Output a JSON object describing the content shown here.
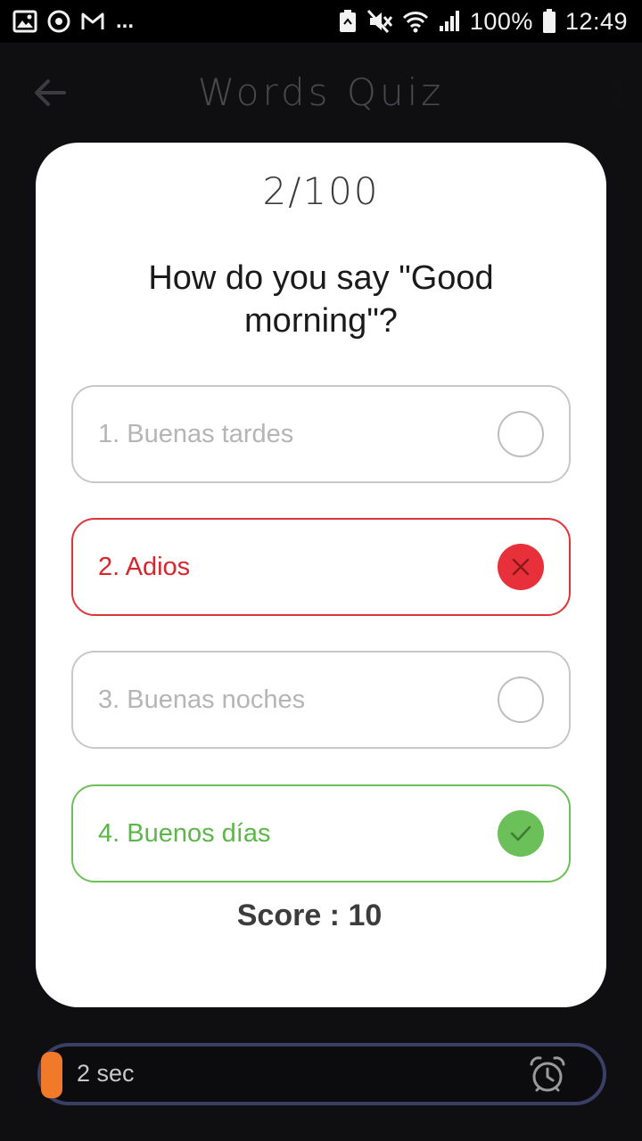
{
  "status_bar": {
    "left_icons": [
      "gallery-icon",
      "timer-icon",
      "gmail-icon"
    ],
    "more": "...",
    "right_icons": [
      "recycle-icon",
      "mute-icon",
      "wifi-icon",
      "signal-icon",
      "battery-icon"
    ],
    "battery": "100%",
    "time": "12:49"
  },
  "app_bar": {
    "title": "Words Quiz",
    "back_icon": "arrow-left-icon",
    "theme_icon": "moon-icon"
  },
  "quiz": {
    "counter": "2/100",
    "question": "How do you say \"Good morning\"?",
    "options": [
      {
        "label": "1. Buenas tardes",
        "state": "neutral"
      },
      {
        "label": "2. Adios",
        "state": "wrong"
      },
      {
        "label": "3. Buenas noches",
        "state": "neutral"
      },
      {
        "label": "4. Buenos días",
        "state": "correct"
      }
    ],
    "score": "Score : 10"
  },
  "timer": {
    "text": "2 sec",
    "icon": "alarm-clock-icon"
  },
  "colors": {
    "wrong": "#e8303a",
    "correct": "#6cc05a",
    "timer_fill": "#f07a2a",
    "moon": "#f4a3c0"
  }
}
